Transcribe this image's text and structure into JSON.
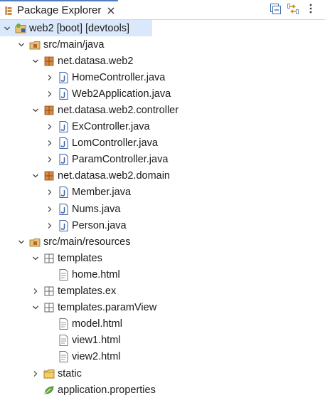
{
  "view": {
    "title": "Package Explorer",
    "icon": "package-explorer-icon",
    "close_icon": "close-icon"
  },
  "toolbar": {
    "buttons": [
      {
        "icon": "collapse-all-icon"
      },
      {
        "icon": "link-with-editor-icon"
      },
      {
        "icon": "view-menu-icon"
      }
    ]
  },
  "tree": {
    "project": "web2 [boot] [devtools]",
    "src_main_java": "src/main/java",
    "pkg_root": "net.datasa.web2",
    "home_controller": "HomeController.java",
    "web2_application": "Web2Application.java",
    "pkg_controller": "net.datasa.web2.controller",
    "ex_controller": "ExController.java",
    "lom_controller": "LomController.java",
    "param_controller": "ParamController.java",
    "pkg_domain": "net.datasa.web2.domain",
    "member": "Member.java",
    "nums": "Nums.java",
    "person": "Person.java",
    "src_main_resources": "src/main/resources",
    "templates": "templates",
    "home_html": "home.html",
    "templates_ex": "templates.ex",
    "templates_paramview": "templates.paramView",
    "model_html": "model.html",
    "view1_html": "view1.html",
    "view2_html": "view2.html",
    "static": "static",
    "application_properties": "application.properties"
  },
  "colors": {
    "selection": "#d9e8fb",
    "tab_accent": "#4f7fc0",
    "package": "#b5652d",
    "java_file": "#3a63a8",
    "folder": "#e1b54f",
    "properties": "#6cae3f"
  }
}
